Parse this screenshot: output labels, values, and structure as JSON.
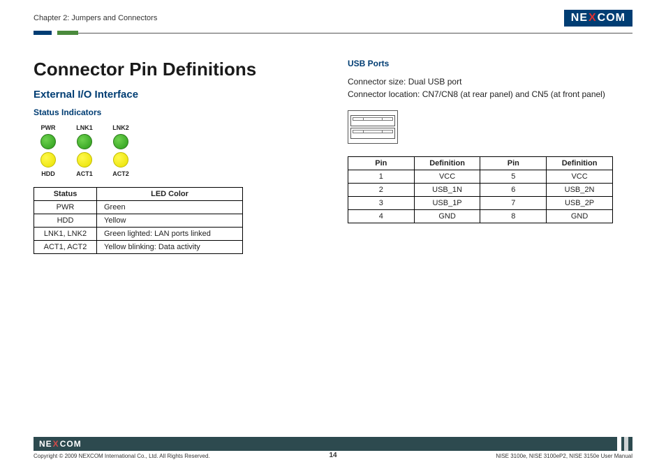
{
  "header": {
    "chapter": "Chapter 2: Jumpers and Connectors",
    "logo_pre": "NE",
    "logo_x": "X",
    "logo_post": "COM"
  },
  "main": {
    "title": "Connector Pin Definitions",
    "subtitle": "External I/O Interface",
    "status_heading": "Status Indicators",
    "leds": {
      "top": [
        "PWR",
        "LNK1",
        "LNK2"
      ],
      "bottom": [
        "HDD",
        "ACT1",
        "ACT2"
      ]
    },
    "status_table": {
      "headers": [
        "Status",
        "LED Color"
      ],
      "rows": [
        [
          "PWR",
          "Green"
        ],
        [
          "HDD",
          "Yellow"
        ],
        [
          "LNK1, LNK2",
          "Green lighted: LAN ports linked"
        ],
        [
          "ACT1, ACT2",
          "Yellow blinking: Data activity"
        ]
      ]
    }
  },
  "usb": {
    "heading": "USB Ports",
    "size": "Connector size: Dual USB port",
    "location": "Connector location: CN7/CN8 (at rear panel) and CN5 (at front panel)",
    "table": {
      "headers": [
        "Pin",
        "Definition",
        "Pin",
        "Definition"
      ],
      "rows": [
        [
          "1",
          "VCC",
          "5",
          "VCC"
        ],
        [
          "2",
          "USB_1N",
          "6",
          "USB_2N"
        ],
        [
          "3",
          "USB_1P",
          "7",
          "USB_2P"
        ],
        [
          "4",
          "GND",
          "8",
          "GND"
        ]
      ]
    }
  },
  "footer": {
    "copyright": "Copyright © 2009 NEXCOM International Co., Ltd. All Rights Reserved.",
    "page": "14",
    "manual": "NISE 3100e, NISE 3100eP2, NISE 3150e User Manual"
  }
}
